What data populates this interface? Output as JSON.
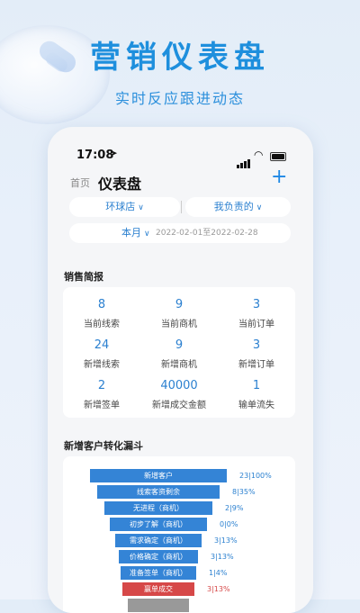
{
  "hero": {
    "title": "营销仪表盘",
    "subtitle": "实时反应跟进动态"
  },
  "status_bar": {
    "time": "17:08"
  },
  "nav": {
    "home": "首页",
    "title": "仪表盘",
    "add_icon": "plus-icon"
  },
  "filters": {
    "store": "环球店",
    "scope": "我负责的",
    "period": "本月",
    "date_range": "2022-02-01至2022-02-28"
  },
  "sales_report": {
    "title": "销售简报",
    "items": [
      {
        "value": "8",
        "label": "当前线索"
      },
      {
        "value": "9",
        "label": "当前商机"
      },
      {
        "value": "3",
        "label": "当前订单"
      },
      {
        "value": "24",
        "label": "新增线索"
      },
      {
        "value": "9",
        "label": "新增商机"
      },
      {
        "value": "3",
        "label": "新增订单"
      },
      {
        "value": "2",
        "label": "新增签单"
      },
      {
        "value": "40000",
        "label": "新增成交金额"
      },
      {
        "value": "1",
        "label": "输单流失"
      }
    ]
  },
  "funnel": {
    "title": "新增客户转化漏斗",
    "stages": [
      {
        "label": "新增客户",
        "value": "23|100%"
      },
      {
        "label": "线索客资剩余",
        "value": "8|35%"
      },
      {
        "label": "无进程（商机）",
        "value": "2|9%"
      },
      {
        "label": "初步了解（商机）",
        "value": "0|0%"
      },
      {
        "label": "需求确定（商机）",
        "value": "3|13%"
      },
      {
        "label": "价格确定（商机）",
        "value": "3|13%"
      },
      {
        "label": "准备签单（商机）",
        "value": "1|4%"
      },
      {
        "label": "赢单成交",
        "value": "3|13%"
      }
    ]
  },
  "colors": {
    "accent": "#1e8fdd",
    "primary": "#3484d6",
    "won": "#d64848"
  }
}
